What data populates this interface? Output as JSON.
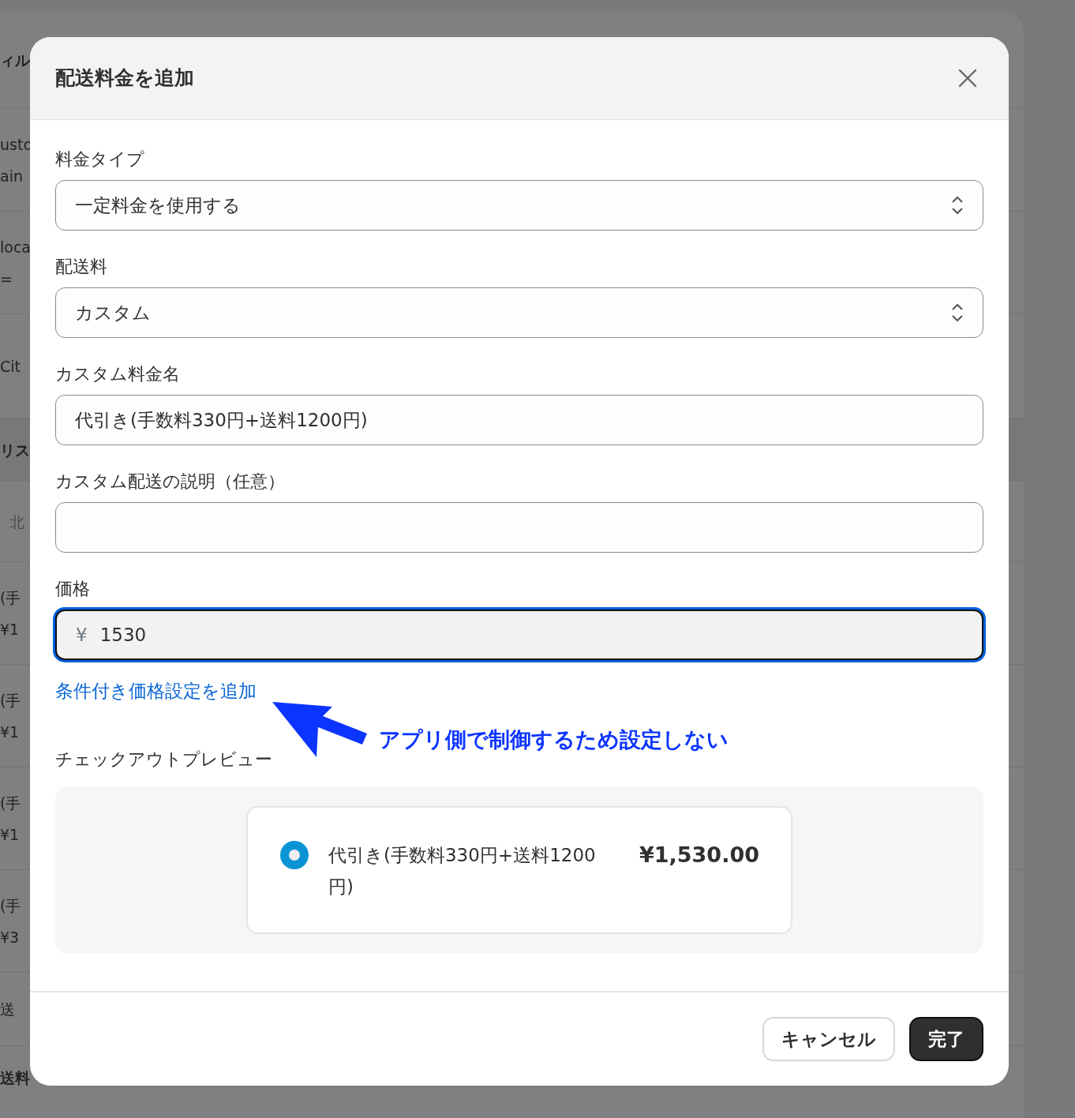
{
  "background_page": {
    "rows": [
      {
        "kind": "heading",
        "lines": [
          "ィル"
        ]
      },
      {
        "kind": "item",
        "lines": [
          "usto",
          "ain"
        ]
      },
      {
        "kind": "item",
        "lines": [
          "loca",
          "="
        ]
      },
      {
        "kind": "item",
        "lines": [
          "Cit"
        ]
      },
      {
        "kind": "band",
        "lines": [
          "リス"
        ]
      },
      {
        "kind": "sub",
        "lines": [
          "北"
        ]
      },
      {
        "kind": "item",
        "lines": [
          "(手",
          "¥1"
        ]
      },
      {
        "kind": "item",
        "lines": [
          "(手",
          "¥1"
        ]
      },
      {
        "kind": "item",
        "lines": [
          "(手",
          "¥1"
        ]
      },
      {
        "kind": "item",
        "lines": [
          "(手",
          "¥3"
        ]
      },
      {
        "kind": "single",
        "lines": [
          "送"
        ]
      },
      {
        "kind": "heading",
        "lines": [
          "送料"
        ]
      }
    ]
  },
  "modal": {
    "title": "配送料金を追加",
    "fields": [
      {
        "kind": "select",
        "label": "料金タイプ",
        "value": "一定料金を使用する"
      },
      {
        "kind": "select",
        "label": "配送料",
        "value": "カスタム"
      },
      {
        "kind": "text",
        "label": "カスタム料金名",
        "value": "代引き(手数料330円+送料1200円)"
      },
      {
        "kind": "text",
        "label": "カスタム配送の説明（任意）"
      },
      {
        "kind": "currency",
        "label": "価格",
        "prefix": "¥",
        "value": "1530",
        "focused": true
      }
    ],
    "link": "条件付き価格設定を追加",
    "annotation": "アプリ側で制御するため設定しない",
    "preview": {
      "label": "チェックアウトプレビュー",
      "option": {
        "name": "代引き(手数料330円+送料1200円)",
        "price": "¥1,530.00",
        "selected": true
      }
    },
    "buttons": [
      {
        "label": "キャンセル",
        "kind": "secondary"
      },
      {
        "label": "完了",
        "kind": "primary"
      }
    ]
  }
}
